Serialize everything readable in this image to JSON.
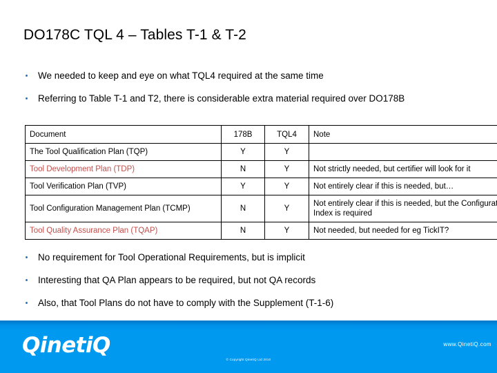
{
  "slide": {
    "title": "DO178C TQL 4 – Tables T-1 & T-2"
  },
  "bullets_top": [
    {
      "text": "We needed to keep and eye on what TQL4 required at the same time"
    },
    {
      "text": "Referring to Table T-1 and T2, there is considerable extra material required over DO178B"
    }
  ],
  "table": {
    "headers": {
      "document": "Document",
      "col_178b": "178B",
      "col_tql4": "TQL4",
      "note": "Note"
    },
    "rows": [
      {
        "document": "The Tool Qualification Plan (TQP)",
        "col_178b": "Y",
        "col_tql4": "Y",
        "note": "",
        "highlight": false
      },
      {
        "document": "Tool Development Plan (TDP)",
        "col_178b": "N",
        "col_tql4": "Y",
        "note": "Not strictly needed, but certifier will look for it",
        "highlight": true
      },
      {
        "document": "Tool Verification Plan (TVP)",
        "col_178b": "Y",
        "col_tql4": "Y",
        "note": "Not entirely clear if this is needed, but…",
        "highlight": false
      },
      {
        "document": "Tool Configuration Management Plan (TCMP)",
        "col_178b": "N",
        "col_tql4": "Y",
        "note": "Not entirely clear if this is needed, but the Configuration Index is required",
        "highlight": false
      },
      {
        "document": "Tool Quality Assurance Plan (TQAP)",
        "col_178b": "N",
        "col_tql4": "Y",
        "note": "Not needed, but needed for eg TickIT?",
        "highlight": true
      }
    ]
  },
  "bullets_bottom": [
    {
      "text": "No requirement for Tool Operational Requirements, but is implicit"
    },
    {
      "text": "Interesting that QA Plan appears to be required, but not QA records"
    },
    {
      "text": "Also, that Tool Plans do not have to comply with the Supplement (T-1-6)"
    }
  ],
  "footer": {
    "logo": "QinetiQ",
    "url": "www.QinetiQ.com",
    "copyright": "© Copyright QinetiQ Ltd 2010"
  },
  "colors": {
    "brand_blue": "#0099F0",
    "highlight_red": "#C0504D",
    "bullet_blue": "#2E74B5",
    "text_black": "#000000"
  }
}
